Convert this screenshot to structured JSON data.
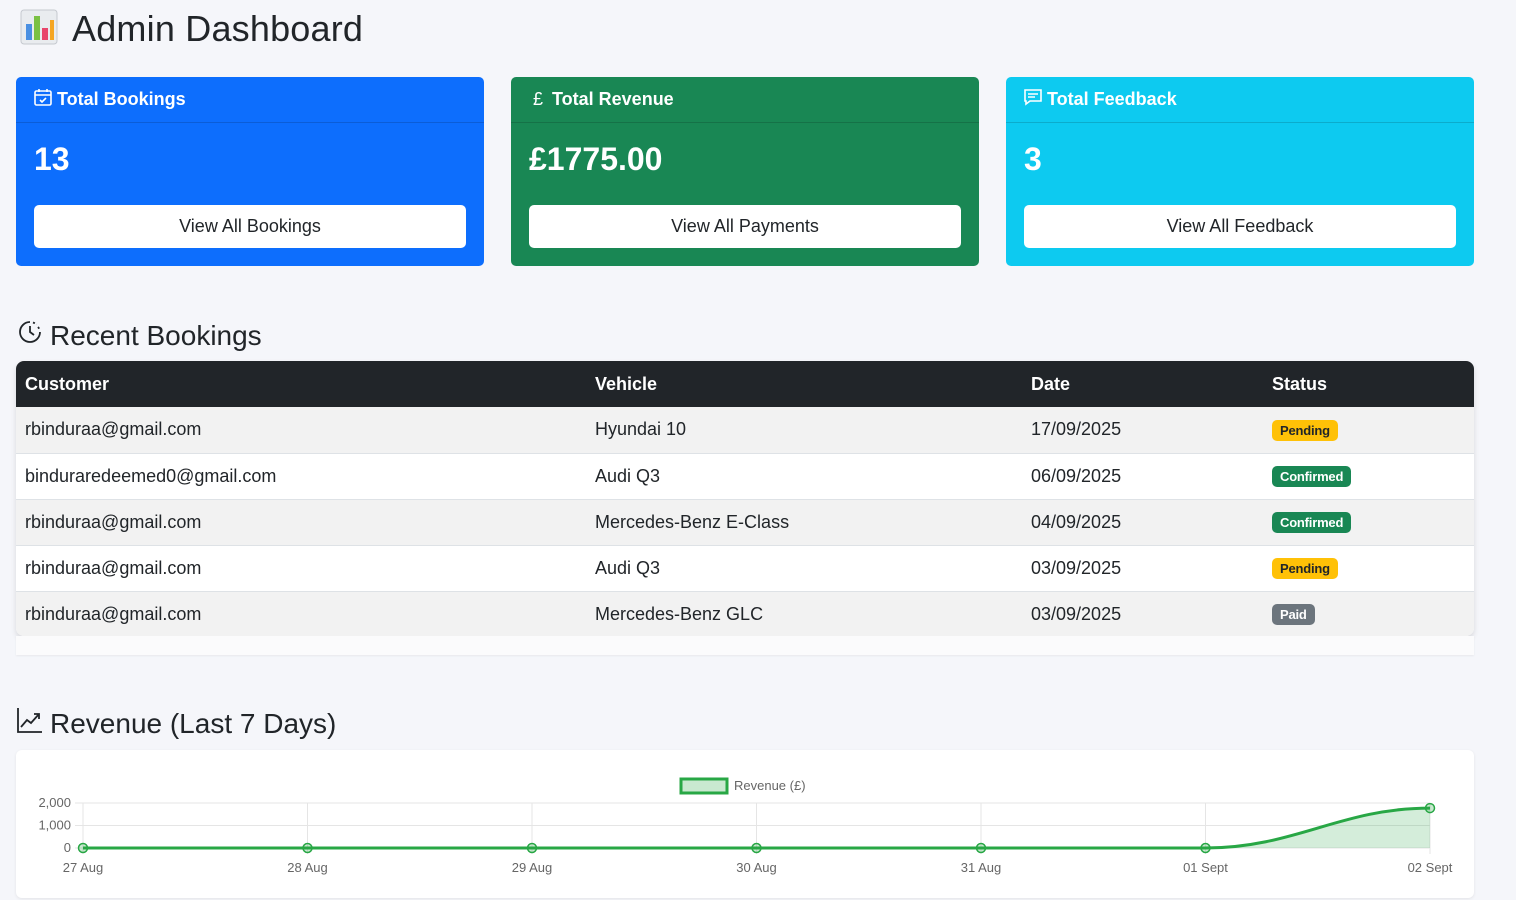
{
  "header": {
    "title": "Admin Dashboard",
    "icon": "bar-chart-icon"
  },
  "cards": [
    {
      "title": "Total Bookings",
      "icon": "calendar-check-icon",
      "value": "13",
      "button": "View All Bookings",
      "color": "#0d6efd"
    },
    {
      "title": "Total Revenue",
      "icon": "pound-icon",
      "icon_glyph": "£",
      "value": "£1775.00",
      "button": "View All Payments",
      "color": "#198754"
    },
    {
      "title": "Total Feedback",
      "icon": "chat-icon",
      "value": "3",
      "button": "View All Feedback",
      "color": "#0dcaf0"
    }
  ],
  "recent": {
    "title": "Recent Bookings",
    "icon": "clock-history-icon",
    "columns": [
      "Customer",
      "Vehicle",
      "Date",
      "Status"
    ],
    "rows": [
      {
        "customer": "rbinduraa@gmail.com",
        "vehicle": "Hyundai 10",
        "date": "17/09/2025",
        "status": "Pending"
      },
      {
        "customer": "binduraredeemed0@gmail.com",
        "vehicle": "Audi Q3",
        "date": "06/09/2025",
        "status": "Confirmed"
      },
      {
        "customer": "rbinduraa@gmail.com",
        "vehicle": "Mercedes-Benz E-Class",
        "date": "04/09/2025",
        "status": "Confirmed"
      },
      {
        "customer": "rbinduraa@gmail.com",
        "vehicle": "Audi Q3",
        "date": "03/09/2025",
        "status": "Pending"
      },
      {
        "customer": "rbinduraa@gmail.com",
        "vehicle": "Mercedes-Benz GLC",
        "date": "03/09/2025",
        "status": "Paid"
      }
    ]
  },
  "revenue": {
    "title": "Revenue (Last 7 Days)",
    "icon": "graph-up-icon"
  },
  "chart_data": {
    "type": "line",
    "x": [
      "27 Aug",
      "28 Aug",
      "29 Aug",
      "30 Aug",
      "31 Aug",
      "01 Sept",
      "02 Sept"
    ],
    "series": [
      {
        "name": "Revenue (£)",
        "values": [
          0,
          0,
          0,
          0,
          0,
          0,
          1775
        ],
        "color": "#28a745"
      }
    ],
    "y_ticks": [
      "0",
      "1,000",
      "2,000"
    ],
    "ylim": [
      0,
      2000
    ],
    "grid": true,
    "legend": "top-center",
    "fill": true
  }
}
